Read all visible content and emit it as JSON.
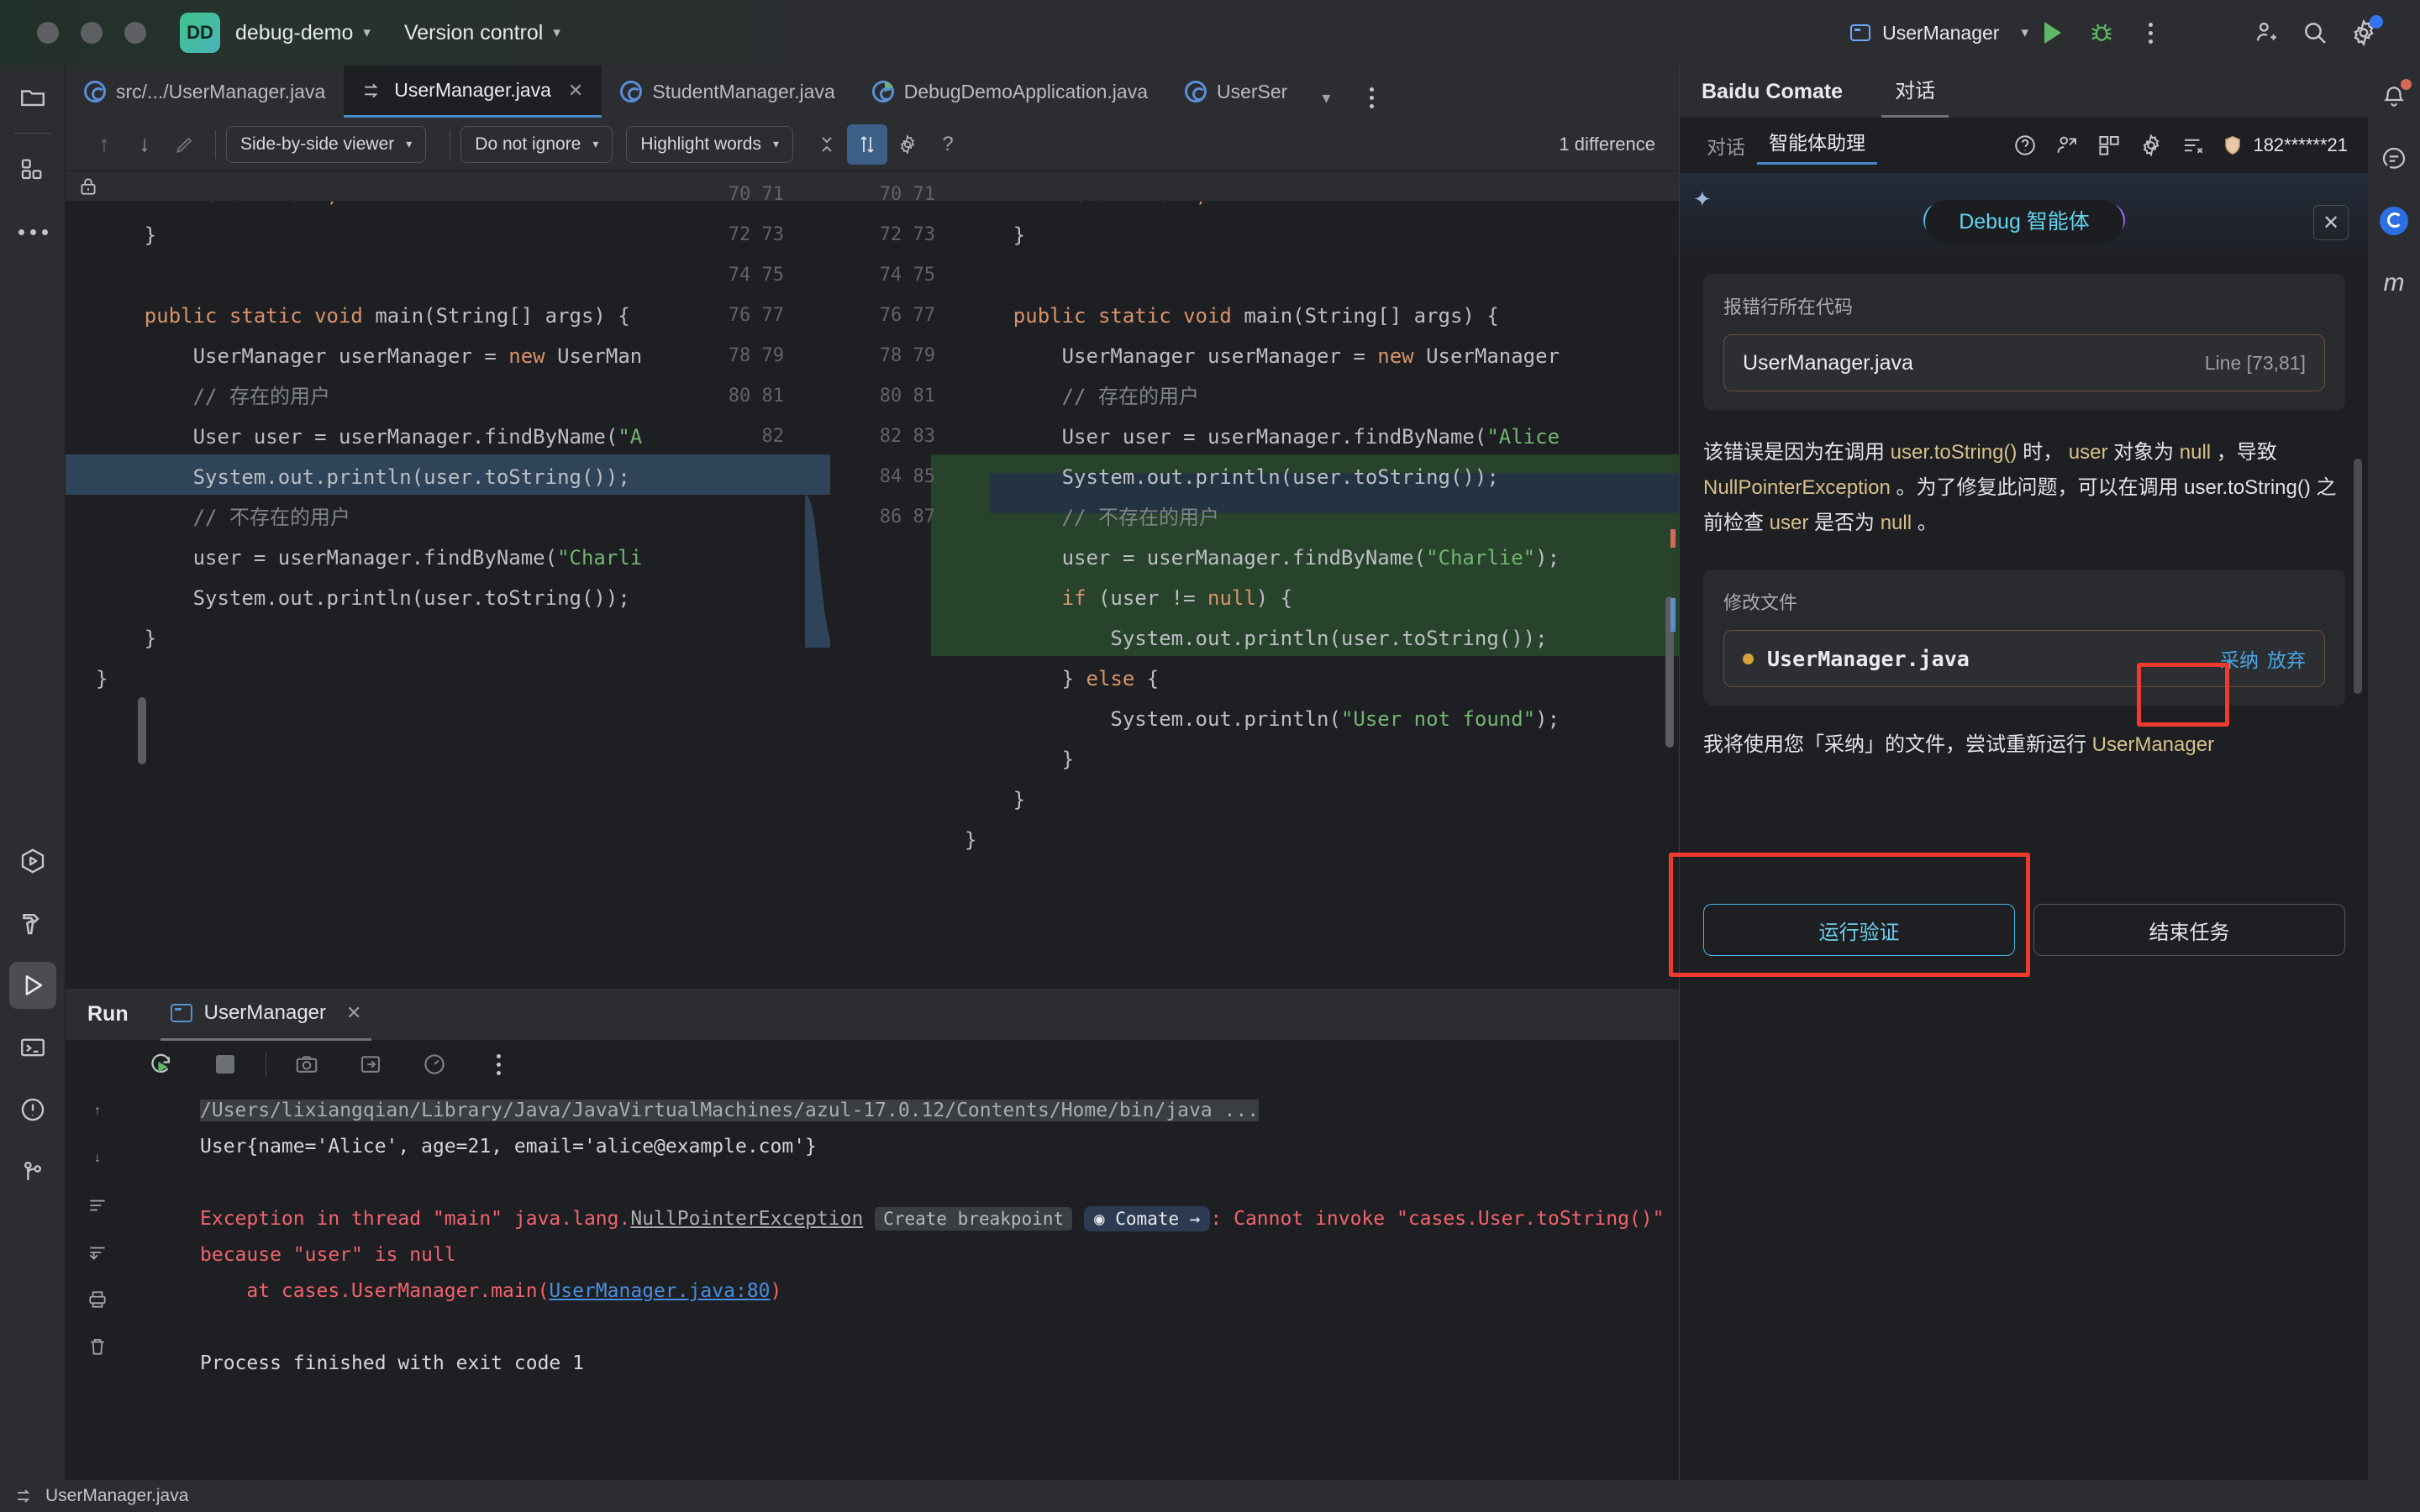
{
  "titlebar": {
    "project_badge": "DD",
    "project_name": "debug-demo",
    "vcs_label": "Version control",
    "run_config": "UserManager",
    "chevron": "⌄"
  },
  "editor_tabs": [
    {
      "label": "src/.../UserManager.java",
      "icon": "java-class-icon",
      "selected": false,
      "closable": false
    },
    {
      "label": "UserManager.java",
      "icon": "diff-icon",
      "selected": true,
      "closable": true
    },
    {
      "label": "StudentManager.java",
      "icon": "java-class-icon",
      "selected": false,
      "closable": false
    },
    {
      "label": "DebugDemoApplication.java",
      "icon": "java-runnable-class-icon",
      "selected": false,
      "closable": false
    },
    {
      "label": "UserSer",
      "icon": "java-class-icon",
      "selected": false,
      "closable": false
    }
  ],
  "diff_toolbar": {
    "prev_diff": "↑",
    "next_diff": "↓",
    "edit": "edit-pencil-icon",
    "viewer_mode": "Side-by-side viewer",
    "ignore_mode": "Do not ignore",
    "highlight_mode": "Highlight words",
    "collapse": "collapse-icon",
    "sync_scroll": "sync-scroll-icon",
    "settings": "gear-icon",
    "help": "?",
    "difference_count": "1 difference"
  },
  "diff_left": {
    "lines": [
      {
        "num": "",
        "text": "        return null;",
        "cls": "pre"
      },
      {
        "num": "",
        "text": "    }",
        "cls": ""
      },
      {
        "num": "",
        "text": "",
        "cls": ""
      },
      {
        "num": "",
        "text": "    public static void main(String[] args) {",
        "cls": ""
      },
      {
        "num": "",
        "text": "        UserManager userManager = new UserMan",
        "cls": ""
      },
      {
        "num": "",
        "text": "        // 存在的用户",
        "cls": "cmt"
      },
      {
        "num": "",
        "text": "        User user = userManager.findByName(\"A",
        "cls": ""
      },
      {
        "num": "",
        "text": "        System.out.println(user.toString());",
        "cls": ""
      },
      {
        "num": "",
        "text": "        // 不存在的用户",
        "cls": "cmt"
      },
      {
        "num": "",
        "text": "        user = userManager.findByName(\"Charli",
        "cls": ""
      },
      {
        "num": "",
        "text": "        System.out.println(user.toString());",
        "cls": "hl"
      },
      {
        "num": "",
        "text": "    }",
        "cls": ""
      },
      {
        "num": "",
        "text": "}",
        "cls": ""
      }
    ],
    "line_numbers": [
      "70",
      "71",
      "72",
      "73",
      "74",
      "75",
      "76",
      "77",
      "78",
      "79",
      "80",
      "81",
      "82"
    ]
  },
  "diff_right": {
    "line_numbers": [
      "70",
      "71",
      "72",
      "73",
      "74",
      "75",
      "76",
      "77",
      "78",
      "79",
      "80",
      "81",
      "82",
      "83",
      "84",
      "85",
      "86",
      "87"
    ],
    "lines": [
      "        return null;",
      "    }",
      "",
      "    public static void main(String[] args) {",
      "        UserManager userManager = new UserManager",
      "        // 存在的用户",
      "        User user = userManager.findByName(\"Alice",
      "        System.out.println(user.toString());",
      "        // 不存在的用户",
      "        user = userManager.findByName(\"Charlie\");",
      "        if (user != null) {",
      "            System.out.println(user.toString());",
      "        } else {",
      "            System.out.println(\"User not found\");",
      "        }",
      "    }",
      "}",
      ""
    ]
  },
  "run_panel": {
    "title": "Run",
    "tab_label": "UserManager",
    "tab_icon": "console-icon",
    "toolbar": [
      "rerun-icon",
      "stop-icon",
      "camera-icon",
      "export-icon",
      "profiler-icon",
      "more-icon"
    ],
    "side_tools": [
      "scroll-up-icon",
      "scroll-down-icon",
      "soft-wrap-icon",
      "scroll-end-icon",
      "print-icon",
      "trash-icon"
    ],
    "console": {
      "line1": "/Users/lixiangqian/Library/Java/JavaVirtualMachines/azul-17.0.12/Contents/Home/bin/java ...",
      "line2": "User{name='Alice', age=21, email='alice@example.com'}",
      "line3_a": "Exception in thread \"main\" java.lang.",
      "line3_npe": "NullPointerException",
      "line3_chip": "Create breakpoint",
      "line3_comate": "Comate →",
      "line3_b": ": Cannot invoke \"cases.User.toString()\" because \"user\" is null",
      "line4_a": "    at cases.UserManager.main(",
      "line4_link": "UserManager.java:80",
      "line4_b": ")",
      "line5": "Process finished with exit code 1"
    }
  },
  "comate": {
    "panel_title": "Baidu Comate",
    "panel_tab": "对话",
    "subtabs": [
      {
        "label": "对话",
        "active": false
      },
      {
        "label": "智能体助理",
        "active": true
      }
    ],
    "icons": [
      "help-icon",
      "share-user-icon",
      "layout-icon",
      "gear-icon",
      "clear-history-icon",
      "shield-badge-icon"
    ],
    "user_account": "182******21",
    "agent_pill": "Debug 智能体",
    "close_label": "✕",
    "error_card": {
      "title": "报错行所在代码",
      "file": "UserManager.java",
      "lines": "Line [73,81]"
    },
    "explanation": {
      "seg1": "该错误是因为在调用 ",
      "tok1": "user.toString()",
      "seg2": " 时， ",
      "tok2": "user",
      "seg3": " 对象为 ",
      "tok3": "null",
      "seg4": " ，导致 ",
      "tok4": "NullPointerException",
      "seg5": " 。为了修复此问题，可以在调用 user.toString() 之前检查 ",
      "tok5": "user",
      "seg6": " 是否为 ",
      "tok6": "null",
      "seg7": " 。"
    },
    "modify_card": {
      "title": "修改文件",
      "file": "UserManager.java",
      "adopt": "采纳",
      "discard": "放弃"
    },
    "followup": {
      "seg1": "我将使用您「采纳」的文件，尝试重新运行 ",
      "tok1": "UserManager"
    },
    "buttons": {
      "primary": "运行验证",
      "secondary": "结束任务"
    }
  },
  "status_bar": {
    "icon": "diff-icon",
    "text": "UserManager.java"
  },
  "colors": {
    "accent_blue": "#4a88c7",
    "run_green": "#5fb865",
    "error_red": "#f0636e",
    "highlight_red": "#ef3b2d",
    "diff_green": "#28432c",
    "diff_blue": "#2f4459",
    "link_blue": "#4aa6e8"
  }
}
